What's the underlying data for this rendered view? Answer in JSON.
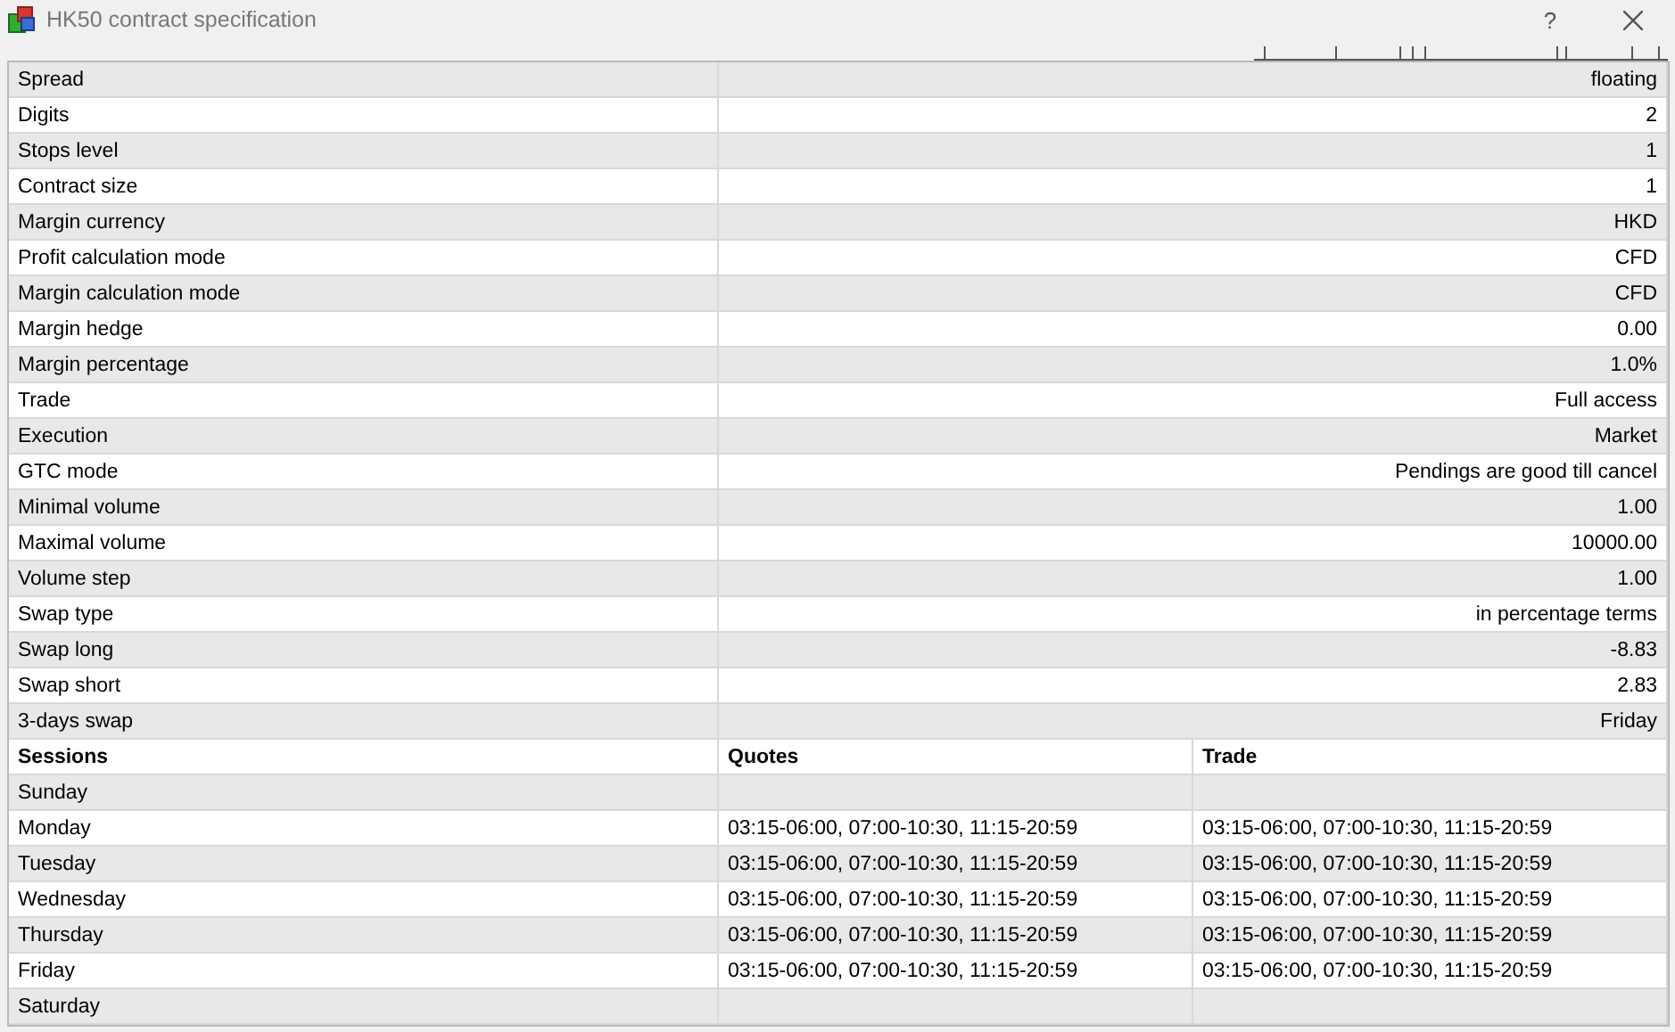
{
  "window": {
    "title": "HK50 contract specification",
    "help": "?"
  },
  "properties": [
    {
      "name": "Spread",
      "value": "floating"
    },
    {
      "name": "Digits",
      "value": "2"
    },
    {
      "name": "Stops level",
      "value": "1"
    },
    {
      "name": "Contract size",
      "value": "1"
    },
    {
      "name": "Margin currency",
      "value": "HKD"
    },
    {
      "name": "Profit calculation mode",
      "value": "CFD"
    },
    {
      "name": "Margin calculation mode",
      "value": "CFD"
    },
    {
      "name": "Margin hedge",
      "value": "0.00"
    },
    {
      "name": "Margin percentage",
      "value": "1.0%"
    },
    {
      "name": "Trade",
      "value": "Full access"
    },
    {
      "name": "Execution",
      "value": "Market"
    },
    {
      "name": "GTC mode",
      "value": "Pendings are good till cancel"
    },
    {
      "name": "Minimal volume",
      "value": "1.00"
    },
    {
      "name": "Maximal volume",
      "value": "10000.00"
    },
    {
      "name": "Volume step",
      "value": "1.00"
    },
    {
      "name": "Swap type",
      "value": "in percentage terms"
    },
    {
      "name": "Swap long",
      "value": "-8.83"
    },
    {
      "name": "Swap short",
      "value": "2.83"
    },
    {
      "name": "3-days swap",
      "value": "Friday"
    }
  ],
  "sessions": {
    "columns": [
      "Sessions",
      "Quotes",
      "Trade"
    ],
    "rows": [
      {
        "day": "Sunday"
      },
      {
        "day": "Monday",
        "quotes": "03:15-06:00, 07:00-10:30, 11:15-20:59",
        "trade": "03:15-06:00, 07:00-10:30, 11:15-20:59"
      },
      {
        "day": "Tuesday",
        "quotes": "03:15-06:00, 07:00-10:30, 11:15-20:59",
        "trade": "03:15-06:00, 07:00-10:30, 11:15-20:59"
      },
      {
        "day": "Wednesday",
        "quotes": "03:15-06:00, 07:00-10:30, 11:15-20:59",
        "trade": "03:15-06:00, 07:00-10:30, 11:15-20:59"
      },
      {
        "day": "Thursday",
        "quotes": "03:15-06:00, 07:00-10:30, 11:15-20:59",
        "trade": "03:15-06:00, 07:00-10:30, 11:15-20:59"
      },
      {
        "day": "Friday",
        "quotes": "03:15-06:00, 07:00-10:30, 11:15-20:59",
        "trade": "03:15-06:00, 07:00-10:30, 11:15-20:59"
      },
      {
        "day": "Saturday"
      }
    ]
  }
}
